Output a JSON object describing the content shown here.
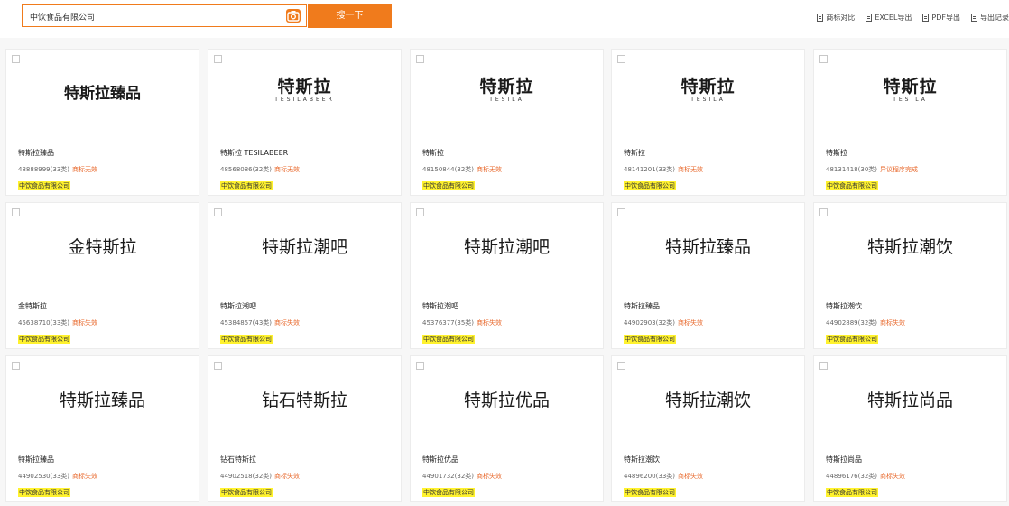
{
  "search": {
    "value": "中饮食品有限公司",
    "button_label": "搜一下"
  },
  "toolbar": {
    "tools": [
      {
        "label": "商标对比",
        "icon": "compare-icon"
      },
      {
        "label": "EXCEL导出",
        "icon": "excel-icon"
      },
      {
        "label": "PDF导出",
        "icon": "pdf-icon"
      },
      {
        "label": "导出记录",
        "icon": "export-record-icon"
      }
    ]
  },
  "colors": {
    "accent": "#f07b1c",
    "status": "#e8672a",
    "highlight": "#fff22e"
  },
  "cards": [
    {
      "mark": "特斯拉臻品",
      "mark_style": "bold",
      "name": "特斯拉臻品",
      "reg": "48888999(33类)",
      "status": "商标无效",
      "owner": "中饮食品有限公司"
    },
    {
      "mark": "特斯拉",
      "mark_sub": "TESILABEER",
      "mark_style": "logo",
      "name": "特斯拉 TESILABEER",
      "reg": "48568086(32类)",
      "status": "商标无效",
      "owner": "中饮食品有限公司"
    },
    {
      "mark": "特斯拉",
      "mark_sub": "TESILA",
      "mark_style": "logo",
      "name": "特斯拉",
      "reg": "48150844(32类)",
      "status": "商标无效",
      "owner": "中饮食品有限公司"
    },
    {
      "mark": "特斯拉",
      "mark_sub": "TESILA",
      "mark_style": "logo",
      "name": "特斯拉",
      "reg": "48141201(33类)",
      "status": "商标无效",
      "owner": "中饮食品有限公司"
    },
    {
      "mark": "特斯拉",
      "mark_sub": "TESILA",
      "mark_style": "logo",
      "name": "特斯拉",
      "reg": "48131418(30类)",
      "status": "异议程序完成",
      "owner": "中饮食品有限公司"
    },
    {
      "mark": "金特斯拉",
      "mark_style": "plain",
      "name": "金特斯拉",
      "reg": "45638710(33类)",
      "status": "商标失效",
      "owner": "中饮食品有限公司"
    },
    {
      "mark": "特斯拉潮吧",
      "mark_style": "plain",
      "name": "特斯拉潮吧",
      "reg": "45384857(43类)",
      "status": "商标失效",
      "owner": "中饮食品有限公司"
    },
    {
      "mark": "特斯拉潮吧",
      "mark_style": "plain",
      "name": "特斯拉潮吧",
      "reg": "45376377(35类)",
      "status": "商标失效",
      "owner": "中饮食品有限公司"
    },
    {
      "mark": "特斯拉臻品",
      "mark_style": "plain",
      "name": "特斯拉臻品",
      "reg": "44902903(32类)",
      "status": "商标失效",
      "owner": "中饮食品有限公司"
    },
    {
      "mark": "特斯拉潮饮",
      "mark_style": "plain",
      "name": "特斯拉潮饮",
      "reg": "44902889(32类)",
      "status": "商标失效",
      "owner": "中饮食品有限公司"
    },
    {
      "mark": "特斯拉臻品",
      "mark_style": "plain",
      "name": "特斯拉臻品",
      "reg": "44902530(33类)",
      "status": "商标失效",
      "owner": "中饮食品有限公司"
    },
    {
      "mark": "钻石特斯拉",
      "mark_style": "plain",
      "name": "钻石特斯拉",
      "reg": "44902518(32类)",
      "status": "商标失效",
      "owner": "中饮食品有限公司"
    },
    {
      "mark": "特斯拉优品",
      "mark_style": "plain",
      "name": "特斯拉优品",
      "reg": "44901732(32类)",
      "status": "商标失效",
      "owner": "中饮食品有限公司"
    },
    {
      "mark": "特斯拉潮饮",
      "mark_style": "plain",
      "name": "特斯拉潮饮",
      "reg": "44896200(33类)",
      "status": "商标失效",
      "owner": "中饮食品有限公司"
    },
    {
      "mark": "特斯拉尚品",
      "mark_style": "plain",
      "name": "特斯拉尚品",
      "reg": "44896176(32类)",
      "status": "商标失效",
      "owner": "中饮食品有限公司"
    }
  ]
}
